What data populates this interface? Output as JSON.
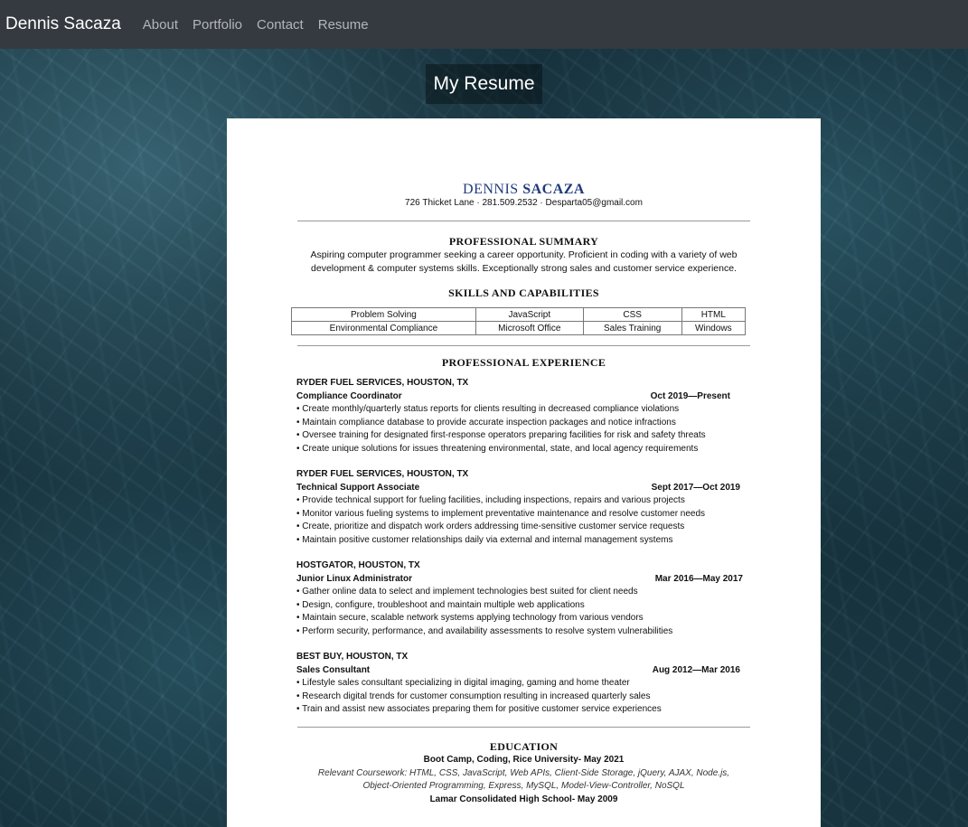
{
  "nav": {
    "brand": "Dennis Sacaza",
    "links": [
      "About",
      "Portfolio",
      "Contact",
      "Resume"
    ]
  },
  "page": {
    "title": "My Resume"
  },
  "resume": {
    "first_name": "DENNIS",
    "last_name": "SACAZA",
    "contact": "726 Thicket Lane · 281.509.2532 · Desparta05@gmail.com",
    "summary_heading": "PROFESSIONAL SUMMARY",
    "summary": "Aspiring computer programmer seeking a career opportunity. Proficient in coding with a variety of web development & computer systems skills. Exceptionally strong sales and customer service experience.",
    "skills_heading": "SKILLS AND CAPABILITIES",
    "skills": [
      [
        "Problem Solving",
        "JavaScript",
        "CSS",
        "HTML"
      ],
      [
        "Environmental Compliance",
        "Microsoft Office",
        "Sales Training",
        "Windows"
      ]
    ],
    "experience_heading": "PROFESSIONAL EXPERIENCE",
    "jobs": [
      {
        "company": "RYDER FUEL SERVICES, HOUSTON, TX",
        "role": "Compliance Coordinator",
        "dates": "Oct 2019—Present",
        "bullets": [
          "Create monthly/quarterly status reports for clients resulting in decreased compliance violations",
          "Maintain compliance database to provide accurate inspection packages and notice infractions",
          "Oversee training for designated first-response operators preparing facilities for risk and safety threats",
          "Create unique solutions for issues threatening environmental, state, and local agency requirements"
        ]
      },
      {
        "company": "RYDER FUEL SERVICES, HOUSTON, TX",
        "role": "Technical Support Associate",
        "dates": "Sept 2017—Oct 2019",
        "bullets": [
          "Provide technical support for fueling facilities, including inspections, repairs and various projects",
          "Monitor various fueling systems to implement preventative maintenance and resolve customer needs",
          "Create, prioritize and dispatch work orders addressing time-sensitive customer service requests",
          "Maintain positive customer relationships daily via external and internal management systems"
        ]
      },
      {
        "company": "HOSTGATOR, HOUSTON, TX",
        "role": "Junior Linux Administrator",
        "dates": "Mar 2016—May 2017",
        "bullets": [
          "Gather online data to select and implement technologies best suited for client needs",
          "Design, configure, troubleshoot and maintain multiple web applications",
          "Maintain secure, scalable network systems applying technology from various vendors",
          "Perform security, performance, and availability assessments to resolve system vulnerabilities"
        ]
      },
      {
        "company": "BEST BUY, HOUSTON, TX",
        "role": "Sales Consultant",
        "dates": "Aug 2012—Mar 2016",
        "bullets": [
          "Lifestyle sales consultant specializing in digital imaging, gaming and home theater",
          "Research digital trends for customer consumption resulting in increased quarterly sales",
          "Train and assist new associates preparing them for positive customer service experiences"
        ]
      }
    ],
    "education_heading": "EDUCATION",
    "education": {
      "bootcamp": "Boot Camp, Coding, Rice University- May 2021",
      "coursework_1": "Relevant Coursework: HTML, CSS, JavaScript, Web APIs, Client-Side Storage, jQuery, AJAX, Node.js,",
      "coursework_2": "Object-Oriented Programming, Express, MySQL, Model-View-Controller, NoSQL",
      "highschool": "Lamar Consolidated High School- May 2009"
    }
  }
}
